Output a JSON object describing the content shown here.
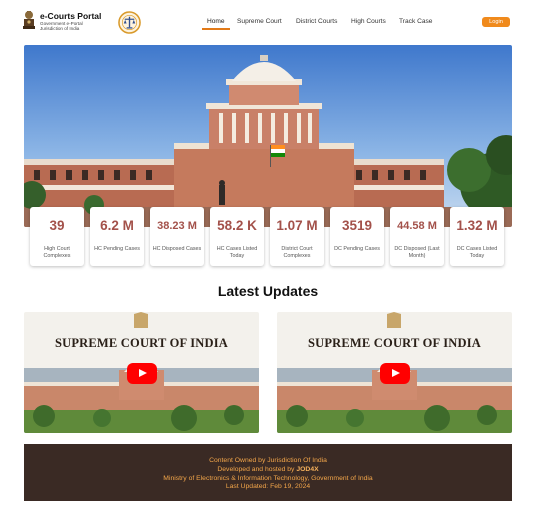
{
  "brand": {
    "title": "e-Courts Portal",
    "subtitle_line1": "Government e-Portal",
    "subtitle_line2": "Jurisdiction of India"
  },
  "nav": {
    "items": [
      {
        "label": "Home",
        "active": true
      },
      {
        "label": "Supreme Court"
      },
      {
        "label": "District Courts"
      },
      {
        "label": "High Courts"
      },
      {
        "label": "Track Case"
      }
    ],
    "login_label": "Login"
  },
  "stats": [
    {
      "value": "39",
      "label": "High Court Complexes"
    },
    {
      "value": "6.2 M",
      "label": "HC Pending Cases"
    },
    {
      "value": "38.23 M",
      "label": "HC Disposed Cases"
    },
    {
      "value": "58.2 K",
      "label": "HC Cases Listed Today"
    },
    {
      "value": "1.07 M",
      "label": "District Court Complexes"
    },
    {
      "value": "3519",
      "label": "DC Pending Cases"
    },
    {
      "value": "44.58 M",
      "label": "DC Disposed (Last Month)"
    },
    {
      "value": "1.32 M",
      "label": "DC Cases Listed Today"
    }
  ],
  "latest_updates": {
    "title": "Latest Updates",
    "videos": [
      {
        "title": "SUPREME COURT OF INDIA"
      },
      {
        "title": "SUPREME COURT OF INDIA"
      }
    ]
  },
  "footer": {
    "line1": "Content Owned by Jurisdiction Of India",
    "line2_prefix": "Developed and hosted by",
    "line2_brand": "JOD4X",
    "line3": "Ministry of Electronics & Information Technology, Government of India",
    "line4": "Last Updated: Feb 19, 2024"
  },
  "colors": {
    "accent": "#f08a1c",
    "stat_value": "#a3514a",
    "footer_bg": "#3a2a24",
    "footer_text": "#f3a64a",
    "play_button": "#ff0000"
  }
}
